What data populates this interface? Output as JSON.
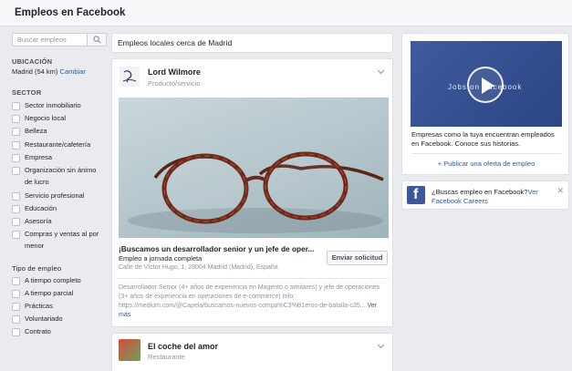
{
  "header": {
    "title": "Empleos en Facebook"
  },
  "sidebar": {
    "search_placeholder": "Buscar empleos",
    "location_heading": "UBICACIÓN",
    "location_value": "Madrid (54 km)",
    "location_change": "Cambiar",
    "sector_heading": "SECTOR",
    "sectors": [
      "Sector inmobiliario",
      "Negocio local",
      "Belleza",
      "Restaurante/cafetería",
      "Empresa",
      "Organización sin ánimo de lucro",
      "Servicio profesional",
      "Educación",
      "Asesoría",
      "Compras y ventas al por menor"
    ],
    "jobtype_heading": "Tipo de empleo",
    "jobtypes": [
      "A tiempo completo",
      "A tiempo parcial",
      "Prácticas",
      "Voluntariado",
      "Contrato"
    ]
  },
  "main": {
    "heading": "Empleos locales cerca de Madrid",
    "post1": {
      "company": "Lord Wilmore",
      "category": "Producto/servicio",
      "job_title": "¡Buscamos un desarrollador senior y un jefe de oper...",
      "job_type": "Empleo a jornada completa",
      "address": "Calle de Víctor Hugo, 1, 28004 Madrid (Madrid), España",
      "apply_label": "Enviar solicitud",
      "description": "Desarrollador Senior (4+ años de experiencia en Magento o similares) y jefe de operaciones (3+ años de experiencia en operaciones de e-commerce) Info: https://medium.com/@Capela/buscamos-nuevos-compa%C3%B1eros-de-batalla-c35...",
      "see_more": "Ver más"
    },
    "post2": {
      "company": "El coche del amor",
      "category": "Restaurante"
    }
  },
  "right": {
    "video_text": "Jobs on Facebook",
    "promo_text": "Empresas como la tuya encuentran empleados en Facebook. Conoce sus historias.",
    "publish_label": "+ Publicar una oferta de empleo",
    "careers_text": "¿Buscas empleo en Facebook?",
    "careers_link": "Ver Facebook Careers",
    "close": "✕"
  },
  "colors": {
    "brand": "#3b5998",
    "link": "#365899",
    "background": "#e9ebee"
  }
}
